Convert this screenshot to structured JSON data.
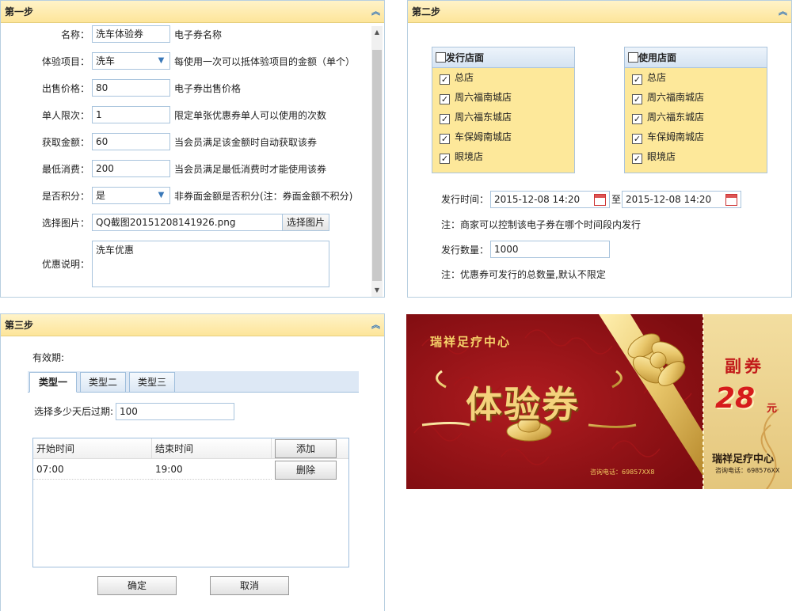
{
  "step1": {
    "title": "第一步",
    "fields": [
      {
        "label": "名称：",
        "value": "洗车体验券",
        "hint": "电子券名称"
      },
      {
        "label": "体验项目：",
        "value": "洗车",
        "hint": "每使用一次可以抵体验项目的金额（单个）"
      },
      {
        "label": "出售价格：",
        "value": "80",
        "hint": "电子券出售价格"
      },
      {
        "label": "单人限次：",
        "value": "1",
        "hint": "限定单张优惠券单人可以使用的次数"
      },
      {
        "label": "获取金额：",
        "value": "60",
        "hint": "当会员满足该金额时自动获取该券"
      },
      {
        "label": "最低消费：",
        "value": "200",
        "hint": "当会员满足最低消费时才能使用该券"
      },
      {
        "label": "是否积分：",
        "value": "是",
        "hint": "非券面金额是否积分(注：券面金额不积分)"
      },
      {
        "label": "选择图片：",
        "value": "QQ截图20151208141926.png",
        "button": "选择图片"
      },
      {
        "label": "优惠说明：",
        "value": "洗车优惠"
      }
    ]
  },
  "step2": {
    "title": "第二步",
    "issue_stores": {
      "title": "发行店面",
      "items": [
        "总店",
        "周六福南城店",
        "周六福东城店",
        "车保姆南城店",
        "眼境店"
      ]
    },
    "use_stores": {
      "title": "使用店面",
      "items": [
        "总店",
        "周六福南城店",
        "周六福东城店",
        "车保姆南城店",
        "眼境店"
      ]
    },
    "issue_time_label": "发行时间：",
    "start_time": "2015-12-08 14:20",
    "to": "至",
    "end_time": "2015-12-08 14:20",
    "time_note": "注：商家可以控制该电子券在哪个时间段内发行",
    "issue_count_label": "发行数量：",
    "issue_count": "1000",
    "count_note": "注：优惠券可发行的总数量,默认不限定"
  },
  "step3": {
    "title": "第三步",
    "validity_label": "有效期:",
    "tabs": [
      "类型一",
      "类型二",
      "类型三"
    ],
    "days_label": "选择多少天后过期:",
    "days_value": "100",
    "table": {
      "headers": [
        "开始时间",
        "结束时间"
      ],
      "rows": [
        [
          "07:00",
          "19:00"
        ]
      ],
      "add": "添加",
      "delete": "删除"
    },
    "confirm": "确定",
    "cancel": "取消"
  },
  "coupon": {
    "brand": "瑞祥足疗中心",
    "title": "体验券",
    "phone": "咨询电话：69857XX8",
    "stub_title": "副券",
    "stub_value": "28",
    "stub_unit": "元",
    "stub_brand": "瑞祥足疗中心",
    "stub_phone": "咨询电话：698576XX"
  },
  "colors": {
    "header_bg": "#fde59a",
    "store_bg": "#fde89a",
    "coupon_red": "#9b1418",
    "coupon_gold": "#e8c66a"
  }
}
